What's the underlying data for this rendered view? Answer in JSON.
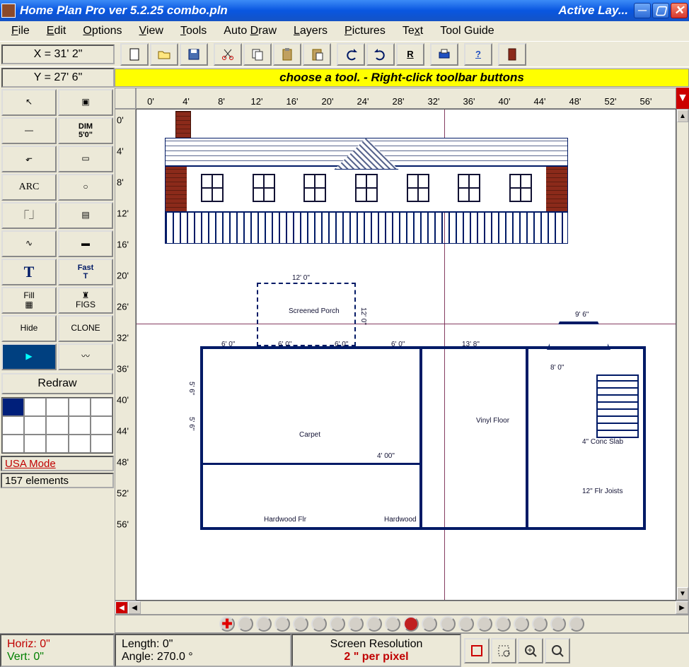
{
  "window": {
    "title": "Home Plan Pro ver 5.2.25   combo.pln",
    "active_layer": "Active Lay..."
  },
  "menu": [
    "File",
    "Edit",
    "Options",
    "View",
    "Tools",
    "Auto Draw",
    "Layers",
    "Pictures",
    "Text",
    "Tool Guide"
  ],
  "coords": {
    "x": "X = 31' 2\"",
    "y": "Y = 27' 6\""
  },
  "hint": "choose a tool.  -  Right-click toolbar buttons",
  "toolbar_icons": [
    "new",
    "open",
    "save",
    "cut",
    "copy",
    "paste",
    "paste-special",
    "undo",
    "redo",
    "repeat",
    "print",
    "help",
    "door"
  ],
  "tool_palette": [
    {
      "name": "pointer",
      "label": "↖"
    },
    {
      "name": "marquee",
      "label": "▣"
    },
    {
      "name": "line",
      "label": "—"
    },
    {
      "name": "dimension",
      "label": "DIM\n5'0\""
    },
    {
      "name": "polyline",
      "label": "⬐"
    },
    {
      "name": "rectangle",
      "label": "▭"
    },
    {
      "name": "arc",
      "label": "ARC"
    },
    {
      "name": "circle",
      "label": "○"
    },
    {
      "name": "door",
      "label": "⎾⏌"
    },
    {
      "name": "window-tool",
      "label": "▤"
    },
    {
      "name": "curve",
      "label": "∿"
    },
    {
      "name": "thick-line",
      "label": "▬"
    },
    {
      "name": "text",
      "label": "T"
    },
    {
      "name": "fast-text",
      "label": "Fast\nT"
    },
    {
      "name": "fill",
      "label": "Fill\n▦"
    },
    {
      "name": "figs",
      "label": "♜\nFIGS"
    },
    {
      "name": "hide",
      "label": "Hide"
    },
    {
      "name": "clone",
      "label": "CLONE"
    },
    {
      "name": "screen",
      "label": "▶"
    },
    {
      "name": "freehand",
      "label": "〰"
    }
  ],
  "redraw_label": "Redraw",
  "mode_label": "USA Mode",
  "elements_label": "157 elements",
  "h_ruler_ticks": [
    "0'",
    "4'",
    "8'",
    "12'",
    "16'",
    "20'",
    "24'",
    "28'",
    "32'",
    "36'",
    "40'",
    "44'",
    "48'",
    "52'",
    "56'"
  ],
  "v_ruler_ticks": [
    "0'",
    "4'",
    "8'",
    "12'",
    "16'",
    "20'",
    "26'",
    "32'",
    "36'",
    "40'",
    "44'",
    "48'",
    "52'",
    "56'"
  ],
  "floorplan": {
    "dim_12_0": "12' 0\"",
    "dim_12_0_v": "12' 0\"",
    "dim_6_0_a": "6' 0\"",
    "dim_6_0_b": "6' 0\"",
    "dim_6_0_c": "6' 0\"",
    "dim_6_0_d": "6' 0\"",
    "dim_5_6": "5' 6\"",
    "dim_5_6_b": "5' 6\"",
    "dim_13_8": "13' 8\"",
    "dim_9_6": "9' 6\"",
    "dim_4_00": "4' 00\"",
    "dim_8_0": "8' 0\"",
    "label_screened_porch": "Screened\nPorch",
    "label_carpet": "Carpet",
    "label_vinyl_floor": "Vinyl\nFloor",
    "label_hardwood_flr": "Hardwood Flr",
    "label_hardwood": "Hardwood",
    "label_4_conc_slab": "4\" Conc Slab",
    "label_12_flr_joists": "12\" Flr Joists"
  },
  "status": {
    "horiz": "Horiz:  0\"",
    "vert": "Vert:   0\"",
    "length": "Length:  0\"",
    "angle": "Angle: 270.0 °",
    "resolution_label": "Screen Resolution",
    "resolution_value": "2 \" per pixel"
  }
}
